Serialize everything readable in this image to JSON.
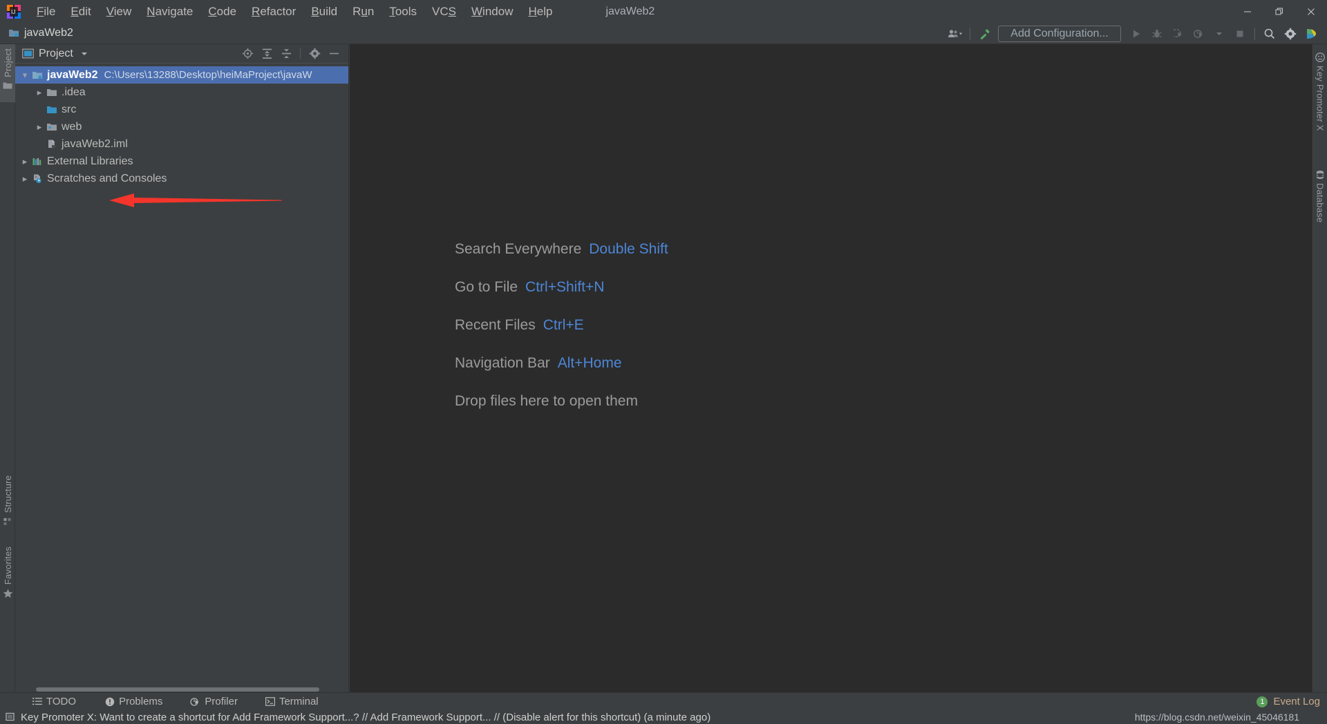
{
  "window": {
    "title": "javaWeb2",
    "minimize_label": "Minimize",
    "maximize_label": "Restore",
    "close_label": "Close"
  },
  "menubar": {
    "items": [
      {
        "label": "File",
        "mnemonic": "F"
      },
      {
        "label": "Edit",
        "mnemonic": "E"
      },
      {
        "label": "View",
        "mnemonic": "V"
      },
      {
        "label": "Navigate",
        "mnemonic": "N"
      },
      {
        "label": "Code",
        "mnemonic": "C"
      },
      {
        "label": "Refactor",
        "mnemonic": "R"
      },
      {
        "label": "Build",
        "mnemonic": "B"
      },
      {
        "label": "Run",
        "mnemonic": "u"
      },
      {
        "label": "Tools",
        "mnemonic": "T"
      },
      {
        "label": "VCS",
        "mnemonic": "S"
      },
      {
        "label": "Window",
        "mnemonic": "W"
      },
      {
        "label": "Help",
        "mnemonic": "H"
      }
    ]
  },
  "toolbar": {
    "project_name": "javaWeb2",
    "add_configuration_label": "Add Configuration...",
    "icons": [
      "user-dropdown-icon",
      "build-hammer-icon",
      "run-icon",
      "debug-icon",
      "run-with-coverage-icon",
      "profile-icon",
      "stop-icon",
      "search-icon",
      "settings-gear-icon",
      "ide-features-trainer-icon"
    ]
  },
  "left_strip": {
    "items": [
      {
        "label": "Project",
        "icon": "project-folder-icon",
        "active": true
      },
      {
        "label": "Structure",
        "icon": "structure-icon",
        "active": false
      },
      {
        "label": "Favorites",
        "icon": "star-icon",
        "active": false
      }
    ]
  },
  "right_strip": {
    "items": [
      {
        "label": "Key Promoter X",
        "icon": "key-promoter-icon"
      },
      {
        "label": "Database",
        "icon": "database-icon"
      }
    ]
  },
  "project_panel": {
    "title": "Project",
    "header_icons": [
      "scroll-from-source-icon",
      "expand-all-icon",
      "collapse-all-icon",
      "settings-gear-icon",
      "hide-icon"
    ],
    "tree": [
      {
        "label": "javaWeb2",
        "path": "C:\\Users\\13288\\Desktop\\heiMaProject\\javaW",
        "icon": "module-folder-icon",
        "arrow": "expanded",
        "indent": 0,
        "selected": true,
        "bold": true
      },
      {
        "label": ".idea",
        "path": "",
        "icon": "folder-icon",
        "arrow": "collapsed",
        "indent": 1,
        "selected": false,
        "bold": false
      },
      {
        "label": "src",
        "path": "",
        "icon": "source-folder-icon",
        "arrow": "none",
        "indent": 1,
        "selected": false,
        "bold": false
      },
      {
        "label": "web",
        "path": "",
        "icon": "web-folder-icon",
        "arrow": "collapsed",
        "indent": 1,
        "selected": false,
        "bold": false
      },
      {
        "label": "javaWeb2.iml",
        "path": "",
        "icon": "iml-file-icon",
        "arrow": "none",
        "indent": 1,
        "selected": false,
        "bold": false
      },
      {
        "label": "External Libraries",
        "path": "",
        "icon": "libraries-icon",
        "arrow": "collapsed",
        "indent": 0,
        "selected": false,
        "bold": false
      },
      {
        "label": "Scratches and Consoles",
        "path": "",
        "icon": "scratches-icon",
        "arrow": "collapsed",
        "indent": 0,
        "selected": false,
        "bold": false
      }
    ]
  },
  "annotation": {
    "type": "red-arrow",
    "points_to": "web",
    "color": "#f4352c"
  },
  "editor": {
    "hints": [
      {
        "label": "Search Everywhere",
        "key": "Double Shift"
      },
      {
        "label": "Go to File",
        "key": "Ctrl+Shift+N"
      },
      {
        "label": "Recent Files",
        "key": "Ctrl+E"
      },
      {
        "label": "Navigation Bar",
        "key": "Alt+Home"
      }
    ],
    "drop_hint": "Drop files here to open them",
    "hint_color": "#9b9b9b",
    "key_color": "#4e86d6"
  },
  "bottom_bar": {
    "items": [
      {
        "label": "TODO",
        "icon": "todo-list-icon"
      },
      {
        "label": "Problems",
        "icon": "problems-icon"
      },
      {
        "label": "Profiler",
        "icon": "profiler-icon"
      },
      {
        "label": "Terminal",
        "icon": "terminal-icon"
      }
    ],
    "event_log_label": "Event Log",
    "event_log_count": "1"
  },
  "status_bar": {
    "message": "Key Promoter X: Want to create a shortcut for Add Framework Support...? // Add Framework Support... // (Disable alert for this shortcut) (a minute ago)",
    "url_watermark": "https://blog.csdn.net/weixin_45046181"
  },
  "colors": {
    "accent_selection": "#4b6eaf",
    "panel_bg": "#3c3f41",
    "editor_bg": "#2b2b2b",
    "text": "#bbbbbb",
    "link": "#4e86d6",
    "arrow_red": "#f4352c"
  }
}
